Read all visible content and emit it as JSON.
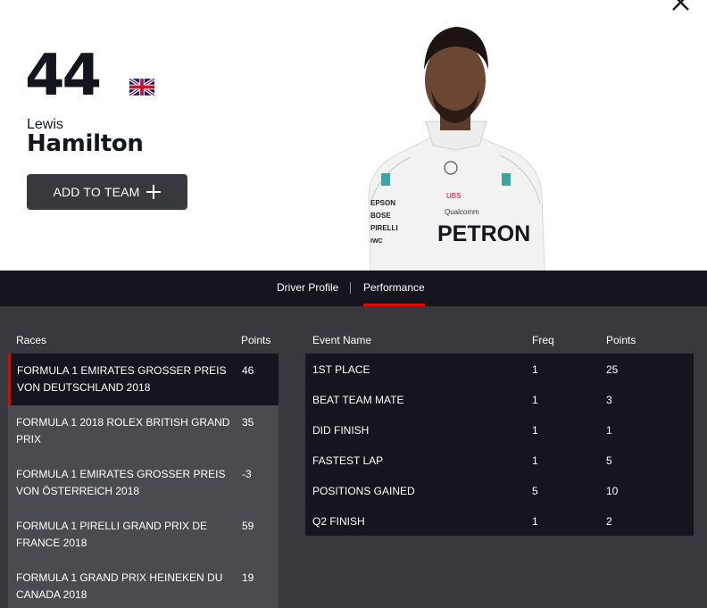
{
  "driver": {
    "number": "44",
    "first_name": "Lewis",
    "last_name": "Hamilton",
    "flag_icon": "uk-flag-icon"
  },
  "hero": {
    "add_button_label": "ADD TO TEAM",
    "add_button_icon": "plus-icon",
    "close_icon": "close-icon"
  },
  "tabs": [
    {
      "label": "Driver Profile",
      "active": false
    },
    {
      "label": "Performance",
      "active": true
    }
  ],
  "races": {
    "headers": {
      "race": "Races",
      "points": "Points"
    },
    "rows": [
      {
        "name": "FORMULA 1 EMIRATES GROSSER PREIS VON DEUTSCHLAND 2018",
        "points": "46",
        "active": true
      },
      {
        "name": "FORMULA 1 2018 ROLEX BRITISH GRAND PRIX",
        "points": "35",
        "active": false
      },
      {
        "name": "FORMULA 1 EMIRATES GROSSER PREIS VON ÖSTERREICH 2018",
        "points": "-3",
        "active": false
      },
      {
        "name": "FORMULA 1 PIRELLI GRAND PRIX DE FRANCE 2018",
        "points": "59",
        "active": false
      },
      {
        "name": "FORMULA 1 GRAND PRIX HEINEKEN DU CANADA 2018",
        "points": "19",
        "active": false
      }
    ]
  },
  "events": {
    "headers": {
      "name": "Event Name",
      "freq": "Freq",
      "points": "Points"
    },
    "rows": [
      {
        "name": "1ST PLACE",
        "freq": "1",
        "points": "25"
      },
      {
        "name": "BEAT TEAM MATE",
        "freq": "1",
        "points": "3"
      },
      {
        "name": "DID FINISH",
        "freq": "1",
        "points": "1"
      },
      {
        "name": "FASTEST LAP",
        "freq": "1",
        "points": "5"
      },
      {
        "name": "POSITIONS GAINED",
        "freq": "5",
        "points": "10"
      },
      {
        "name": "Q2 FINISH",
        "freq": "1",
        "points": "2"
      }
    ]
  },
  "colors": {
    "dark": "#15151e",
    "panel": "#38383f",
    "row": "#4a4a51",
    "accent": "#e10600"
  }
}
